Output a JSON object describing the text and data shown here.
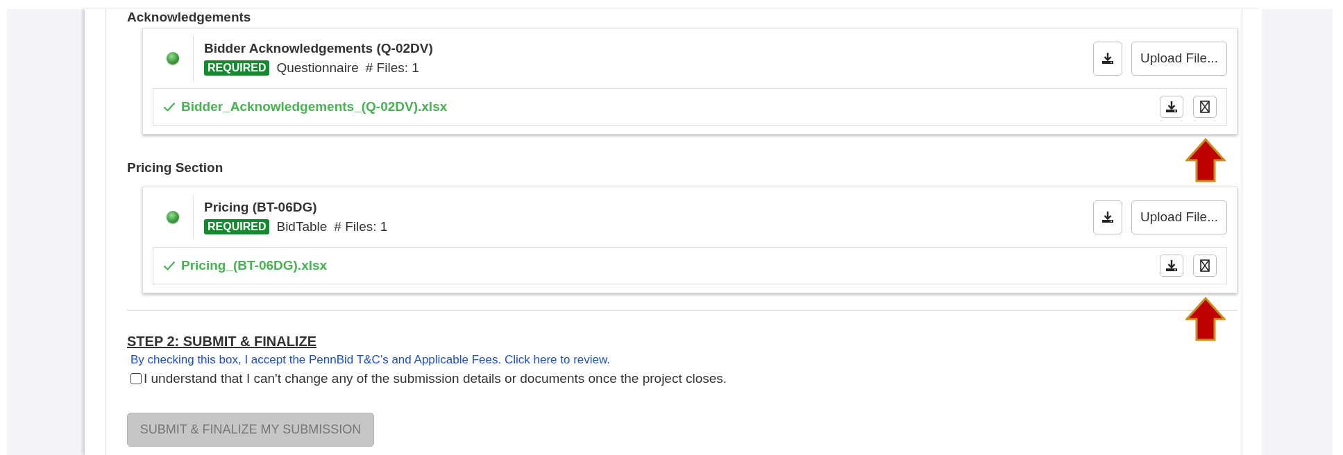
{
  "sections": [
    {
      "heading": "Acknowledgements",
      "documents": [
        {
          "title": "Bidder Acknowledgements (Q-02DV)",
          "badge": "REQUIRED",
          "type": "Questionnaire",
          "files_count": "# Files: 1",
          "upload_label": "Upload File...",
          "files": [
            {
              "name": "Bidder_Acknowledgements_(Q-02DV).xlsx",
              "uploaded": true,
              "pointed": true
            }
          ]
        }
      ]
    },
    {
      "heading": "Pricing Section",
      "documents": [
        {
          "title": "Pricing (BT-06DG)",
          "badge": "REQUIRED",
          "type": "BidTable",
          "files_count": "# Files: 1",
          "upload_label": "Upload File...",
          "files": [
            {
              "name": "Pricing_(BT-06DG).xlsx",
              "uploaded": true,
              "pointed": true
            }
          ]
        }
      ]
    }
  ],
  "step": {
    "heading": "STEP 2: SUBMIT & FINALIZE",
    "terms_link": "By checking this box, I accept the PennBid T&C’s and Applicable Fees. Click here to review.",
    "agreement": {
      "label": "I understand that I can't change any of the submission details or documents once the project closes.",
      "checked": false
    },
    "submit": {
      "label": "SUBMIT & FINALIZE MY SUBMISSION",
      "disabled": true
    }
  }
}
